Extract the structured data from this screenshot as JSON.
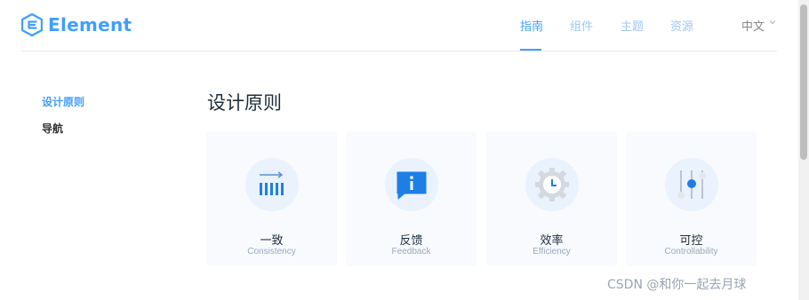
{
  "header": {
    "logo_text": "Element",
    "nav": [
      "指南",
      "组件",
      "主题",
      "资源"
    ],
    "lang": "中文"
  },
  "sidebar": {
    "items": [
      {
        "label": "设计原则",
        "active": true
      },
      {
        "label": "导航",
        "active": false
      }
    ]
  },
  "main": {
    "title": "设计原则",
    "cards": [
      {
        "title": "一致",
        "subtitle": "Consistency",
        "icon": "consistency-icon"
      },
      {
        "title": "反馈",
        "subtitle": "Feedback",
        "icon": "feedback-icon"
      },
      {
        "title": "效率",
        "subtitle": "Efficiency",
        "icon": "efficiency-icon"
      },
      {
        "title": "可控",
        "subtitle": "Controllability",
        "icon": "controllability-icon"
      }
    ]
  },
  "watermark": "CSDN @和你一起去月球",
  "colors": {
    "accent": "#409eff",
    "nav_inactive": "#9ec8f5",
    "card_bg": "#f8fafe",
    "icon_bg": "#e9f2fd"
  }
}
